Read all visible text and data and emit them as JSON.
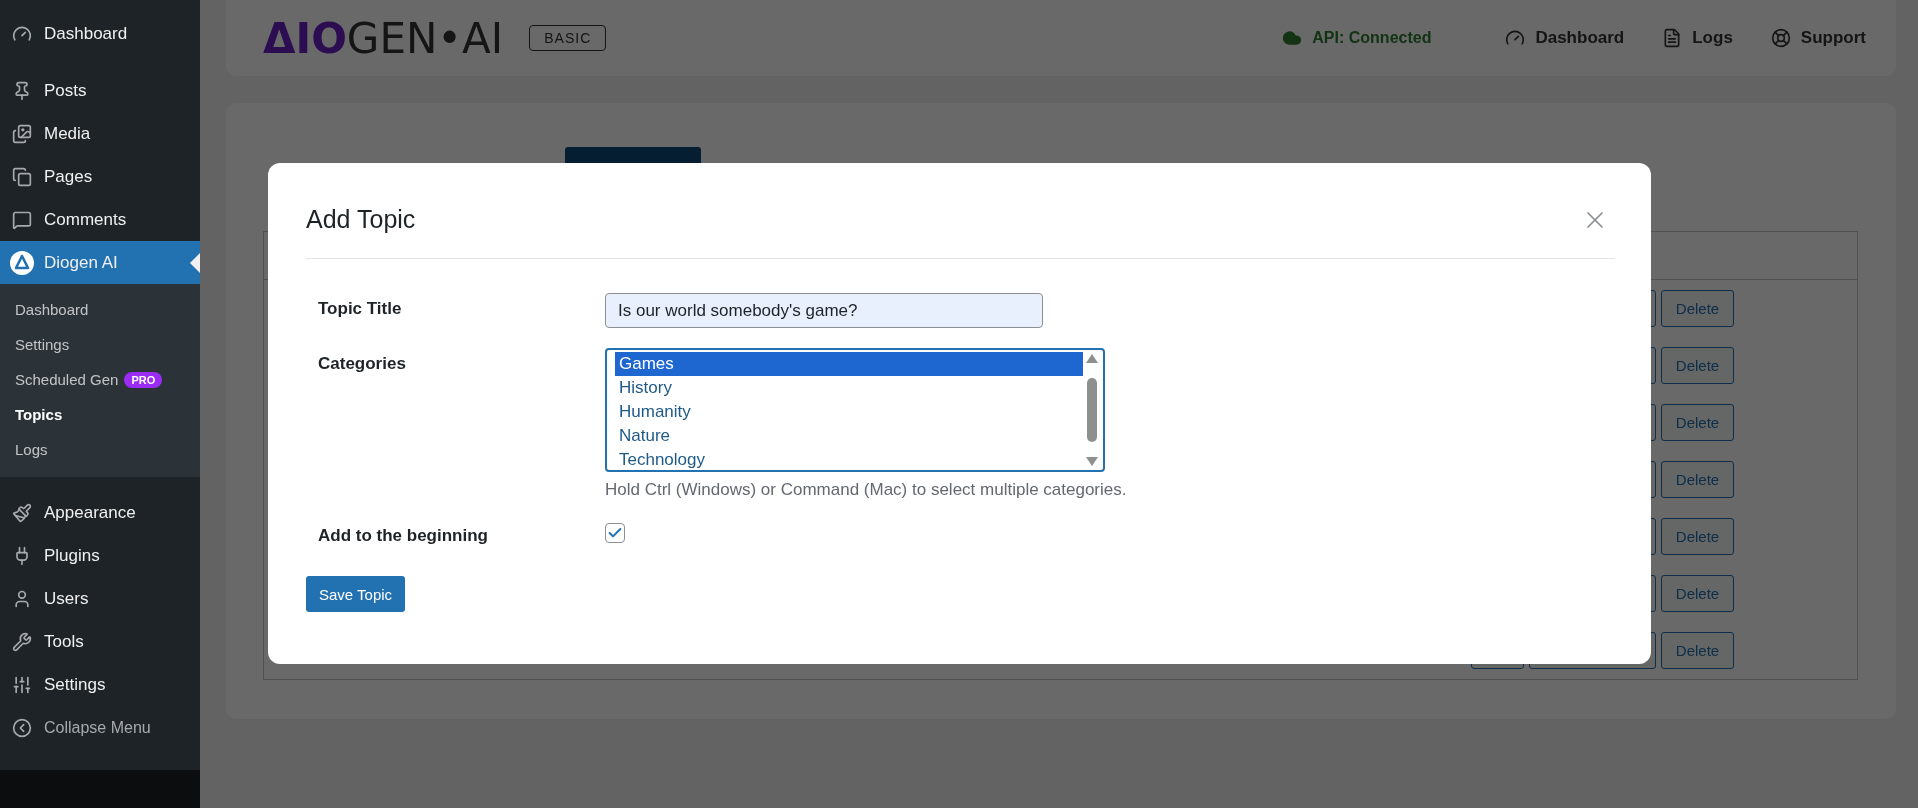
{
  "sidebar": {
    "groups": [
      [
        {
          "label": "Dashboard",
          "selected": false
        }
      ],
      [
        {
          "label": "Posts",
          "selected": false
        },
        {
          "label": "Media",
          "selected": false
        },
        {
          "label": "Pages",
          "selected": false
        },
        {
          "label": "Comments",
          "selected": false
        },
        {
          "label": "Diogen AI",
          "selected": true,
          "children": [
            {
              "label": "Dashboard",
              "selected": false
            },
            {
              "label": "Settings",
              "selected": false
            },
            {
              "label": "Scheduled Gen",
              "selected": false,
              "badge": "PRO"
            },
            {
              "label": "Topics",
              "selected": true
            },
            {
              "label": "Logs",
              "selected": false
            }
          ]
        }
      ],
      [
        {
          "label": "Appearance",
          "selected": false
        },
        {
          "label": "Plugins",
          "selected": false
        },
        {
          "label": "Users",
          "selected": false
        },
        {
          "label": "Tools",
          "selected": false
        },
        {
          "label": "Settings",
          "selected": false
        }
      ]
    ],
    "collapse": "Collapse Menu"
  },
  "header": {
    "logo": {
      "accent": "ΔIO",
      "rest": "GEN•AI"
    },
    "plan_badge": "BASIC",
    "api_status": {
      "label": "API: Connected",
      "connected": true
    },
    "nav": [
      "Dashboard",
      "Logs",
      "Support"
    ]
  },
  "page": {
    "rows": [
      {
        "action": "Delete"
      },
      {
        "action": "Delete"
      },
      {
        "action": "Delete"
      },
      {
        "action": "Delete"
      },
      {
        "action": "Delete"
      },
      {
        "action": "Delete"
      },
      {
        "action": "Delete"
      }
    ]
  },
  "modal": {
    "title": "Add Topic",
    "fields": [
      {
        "kind": "text",
        "label": "Topic Title",
        "value": "Is our world somebody's game?"
      },
      {
        "kind": "multiselect",
        "label": "Categories",
        "options": [
          {
            "label": "Games",
            "selected": true
          },
          {
            "label": "History",
            "selected": false
          },
          {
            "label": "Humanity",
            "selected": false
          },
          {
            "label": "Nature",
            "selected": false
          },
          {
            "label": "Technology",
            "selected": false
          }
        ],
        "help": "Hold Ctrl (Windows) or Command (Mac) to select multiple categories."
      },
      {
        "kind": "checkbox",
        "label": "Add to the beginning",
        "checked": true
      }
    ],
    "save": "Save Topic"
  }
}
